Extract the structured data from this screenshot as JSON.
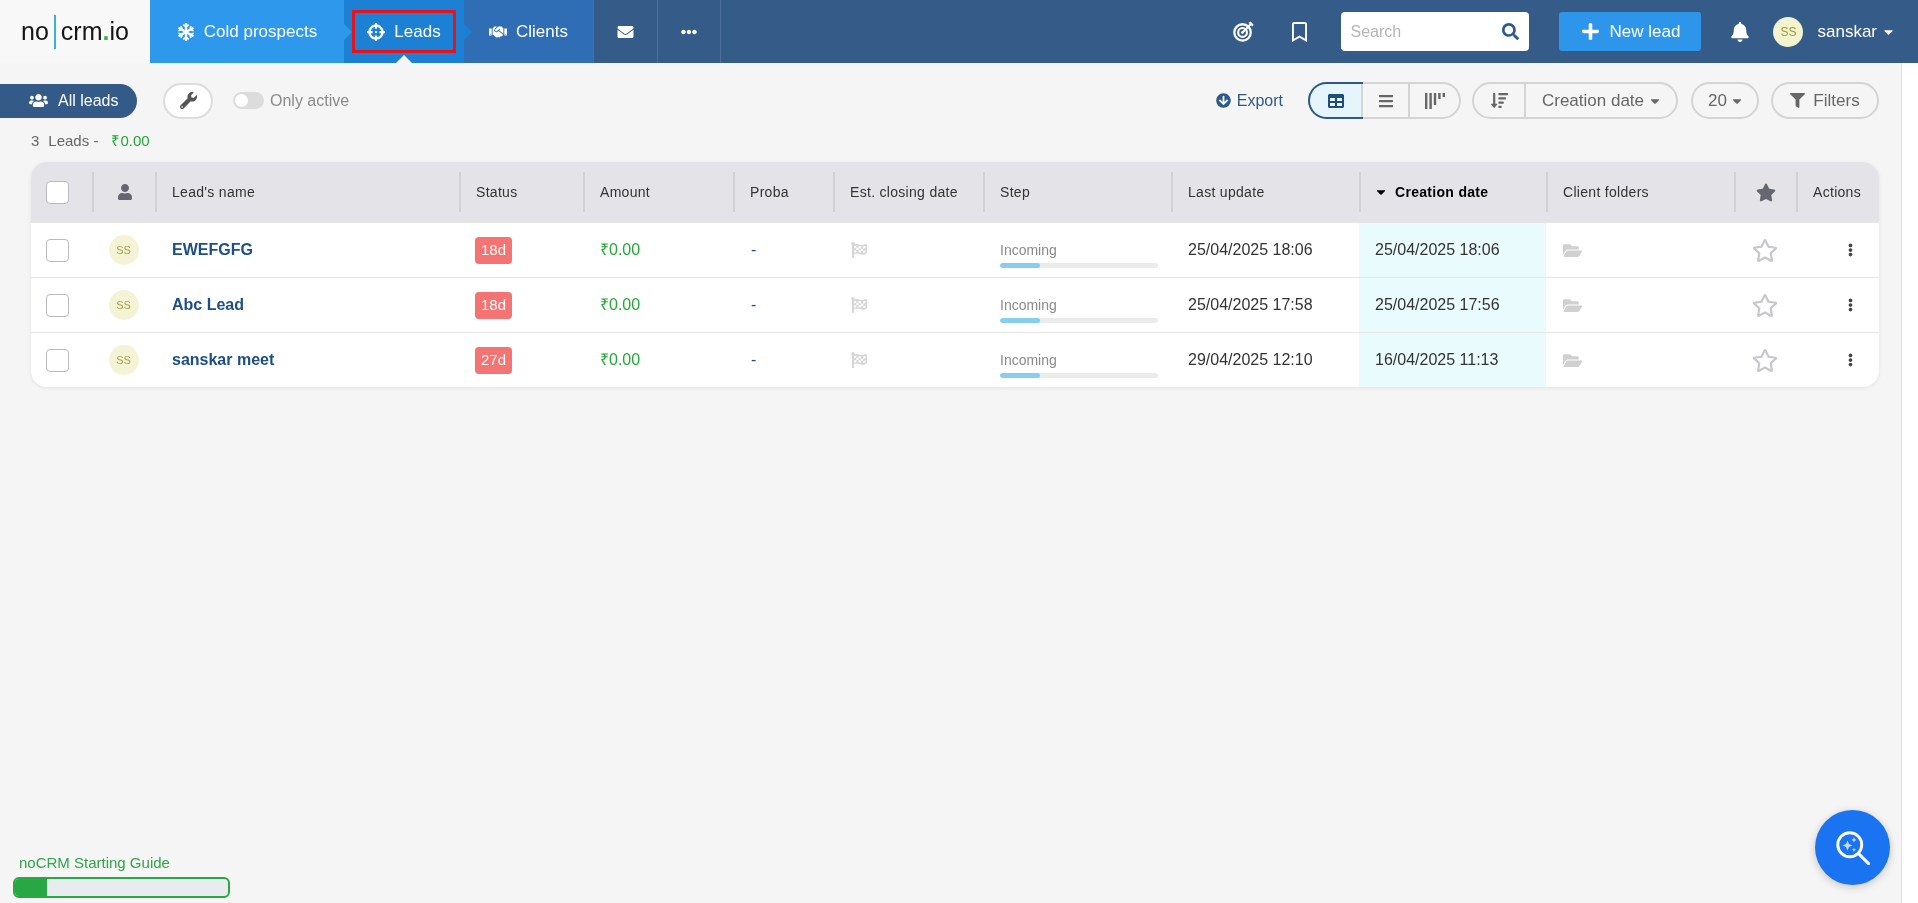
{
  "logo": {
    "left": "no",
    "right": "crm",
    "dot": ".",
    "suffix": "io"
  },
  "nav": {
    "tabs": [
      {
        "label": "Cold prospects",
        "selected": false,
        "highlighted": false
      },
      {
        "label": "Leads",
        "selected": true,
        "highlighted": true
      },
      {
        "label": "Clients",
        "selected": false,
        "highlighted": false
      }
    ]
  },
  "search": {
    "placeholder": "Search"
  },
  "new_lead_button": "New lead",
  "user": {
    "initials": "SS",
    "name": "sanskar"
  },
  "toolbar": {
    "all_leads": "All leads",
    "only_active": {
      "label": "Only active",
      "on": false
    },
    "export": "Export",
    "view_modes": [
      {
        "kind": "table",
        "selected": true
      },
      {
        "kind": "list",
        "selected": false
      },
      {
        "kind": "kanban",
        "selected": false
      }
    ],
    "sort": {
      "label": "Creation date"
    },
    "per_page": "20",
    "filters": "Filters"
  },
  "summary": {
    "count": "3",
    "label": "Leads -",
    "amount": "₹0.00"
  },
  "table": {
    "columns": [
      {
        "kind": "checkbox",
        "checked": false
      },
      {
        "kind": "owner"
      },
      {
        "kind": "text",
        "label": "Lead's name",
        "sorted": false
      },
      {
        "kind": "text",
        "label": "Status",
        "sorted": false
      },
      {
        "kind": "text",
        "label": "Amount",
        "sorted": false
      },
      {
        "kind": "text",
        "label": "Proba",
        "sorted": false
      },
      {
        "kind": "text",
        "label": "Est. closing date",
        "sorted": false
      },
      {
        "kind": "text",
        "label": "Step",
        "sorted": false
      },
      {
        "kind": "text",
        "label": "Last update",
        "sorted": false
      },
      {
        "kind": "text",
        "label": "Creation date",
        "sorted": true
      },
      {
        "kind": "text",
        "label": "Client folders",
        "sorted": false
      },
      {
        "kind": "favorite"
      },
      {
        "kind": "text",
        "label": "Actions",
        "sorted": false
      }
    ],
    "rows": [
      {
        "checked": false,
        "owner": "SS",
        "name": "EWEFGFG",
        "status": "18d",
        "amount": "₹0.00",
        "proba": "-",
        "step": {
          "label": "Incoming",
          "level": 0.25
        },
        "last_update": "25/04/2025 18:06",
        "creation_date": "25/04/2025 18:06",
        "starred": false
      },
      {
        "checked": false,
        "owner": "SS",
        "name": "Abc Lead",
        "status": "18d",
        "amount": "₹0.00",
        "proba": "-",
        "step": {
          "label": "Incoming",
          "level": 0.25
        },
        "last_update": "25/04/2025 17:58",
        "creation_date": "25/04/2025 17:56",
        "starred": false
      },
      {
        "checked": false,
        "owner": "SS",
        "name": "sanskar meet",
        "status": "27d",
        "amount": "₹0.00",
        "proba": "-",
        "step": {
          "label": "Incoming",
          "level": 0.25
        },
        "last_update": "29/04/2025 12:10",
        "creation_date": "16/04/2025 11:13",
        "starred": false
      }
    ]
  },
  "guide": {
    "title": "noCRM Starting Guide",
    "level": 0.15
  }
}
